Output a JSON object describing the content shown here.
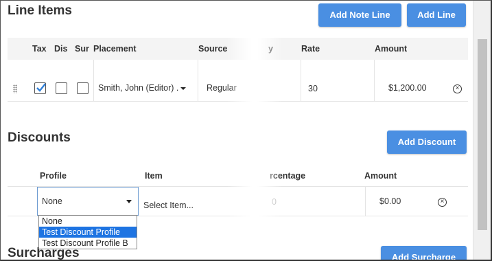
{
  "line_items": {
    "title": "Line Items",
    "add_note_label": "Add Note Line",
    "add_line_label": "Add Line",
    "columns": {
      "tax": "Tax",
      "dis": "Dis",
      "sur": "Sur",
      "placement": "Placement",
      "source": "Source",
      "qty_fragment": "y",
      "rate": "Rate",
      "amount": "Amount"
    },
    "row": {
      "tax_checked": true,
      "dis_checked": false,
      "sur_checked": false,
      "placement": "Smith, John (Editor) .",
      "source": "Regular",
      "rate": "30",
      "amount": "$1,200.00"
    }
  },
  "discounts": {
    "title": "Discounts",
    "add_label": "Add Discount",
    "columns": {
      "profile": "Profile",
      "item": "Item",
      "percentage_fragment": "rcentage",
      "amount": "Amount"
    },
    "row": {
      "profile_selected": "None",
      "item_placeholder": "Select Item...",
      "percentage_fragment": "0",
      "amount": "$0.00"
    },
    "dropdown_options": [
      "None",
      "Test Discount Profile",
      "Test Discount Profile B"
    ],
    "highlighted_option": "Test Discount Profile"
  },
  "surcharges": {
    "title": "Surcharges",
    "add_label": "Add Surcharge"
  },
  "colors": {
    "button": "#4a8fe2",
    "highlight": "#1e74e2",
    "checkmark": "#2f7fd8"
  }
}
